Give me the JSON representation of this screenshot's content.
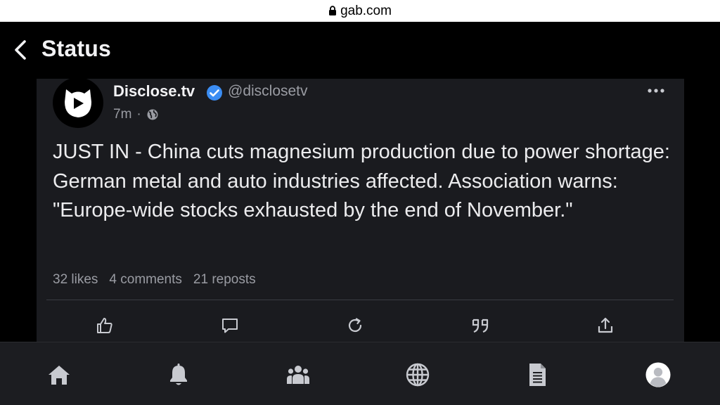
{
  "browser": {
    "url": "gab.com"
  },
  "header": {
    "title": "Status"
  },
  "post": {
    "author_name": "Disclose.tv",
    "author_handle": "@disclosetv",
    "time": "7m",
    "separator": "·",
    "text": "JUST IN - China cuts magnesium production due to power shortage: German metal and auto industries affected. Association warns: \"Europe-wide stocks exhausted by the end of November.\"",
    "stats": {
      "likes": "32 likes",
      "comments": "4 comments",
      "reposts": "21 reposts"
    }
  },
  "actions": [
    "like-icon",
    "comment-icon",
    "repost-icon",
    "quote-icon",
    "share-icon"
  ],
  "nav": [
    "home-icon",
    "bell-icon",
    "groups-icon",
    "globe-icon",
    "document-icon",
    "profile-avatar-icon"
  ],
  "colors": {
    "background": "#000000",
    "card": "#1a1b1f",
    "nav": "#1c1d21",
    "verified": "#3b8df3",
    "muted": "#9a9ca3",
    "icon": "#c8cad0"
  }
}
